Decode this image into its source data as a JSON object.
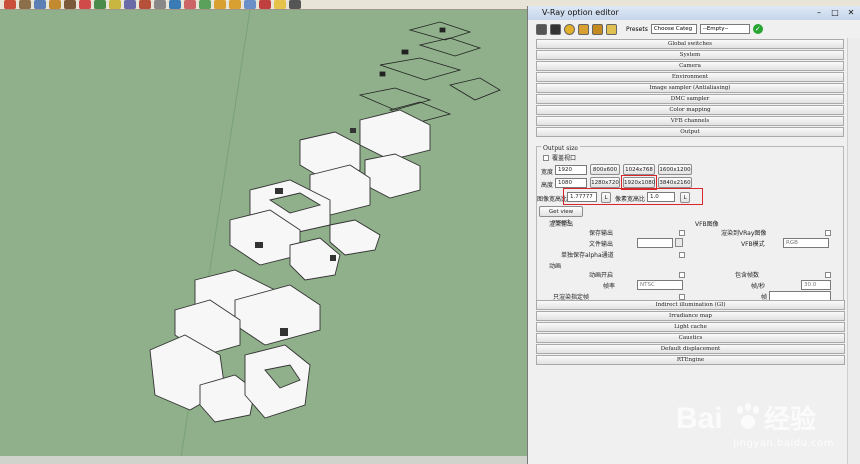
{
  "window": {
    "title": "V-Ray option editor",
    "controls": [
      "–",
      "□",
      "✕"
    ]
  },
  "colors": {
    "viewport_bg": "#8fb08a",
    "highlight_red": "#d9262a",
    "ok_green": "#27a532"
  },
  "editor": {
    "presets_label": "Presets",
    "presets_category": "Choose Categ",
    "presets_value": "--Empty--",
    "sections_top": [
      "Global switches",
      "System",
      "Camera",
      "Environment",
      "Image sampler (Antialiasing)",
      "DMC sampler",
      "Color mapping",
      "VFB channels",
      "Output"
    ],
    "output": {
      "output_size_label": "Output size",
      "override_viewport_label": "覆盖视口",
      "width_label": "宽度",
      "width_value": "1920",
      "height_label": "高度",
      "height_value": "1080",
      "presets_row1": [
        "800x600",
        "1024x768",
        "1600x1200"
      ],
      "presets_row2": [
        "1280x720",
        "1920x1080",
        "3840x2160"
      ],
      "image_aspect_label": "图像宽高比",
      "image_aspect_value": "1.77777",
      "lock_label": "L",
      "pixel_aspect_label": "像素宽高比",
      "pixel_aspect_value": "1.0",
      "get_view_aspect": "Get view aspect",
      "render_output_label": "渲染输出",
      "save_output_label": "保存输出",
      "file_output_label": "文件输出",
      "alpha_label": "单独保存alpha通道",
      "vfb_label": "VFB图像",
      "render_to_vray_label": "渲染到VRay图像",
      "vfb_mode_label": "VFB模式",
      "vfb_mode_value": "RGB",
      "animation_label": "动画",
      "anim_enable_label": "动画开启",
      "include_frame_label": "包含帧数",
      "frame_rate_label": "帧率",
      "frame_rate_value": "NTSC",
      "fps_label": "帧/秒",
      "fps_value": "30.0",
      "render_specific_label": "只渲染指定帧",
      "frame_label": "帧"
    },
    "sections_bottom": [
      "Indirect illumination (GI)",
      "Irradiance map",
      "Light cache",
      "Caustics",
      "Default displacement",
      "RTEngine"
    ]
  },
  "watermark": {
    "brand_left": "Bai",
    "brand_right": "经验",
    "url": "jingyan.baidu.com"
  }
}
